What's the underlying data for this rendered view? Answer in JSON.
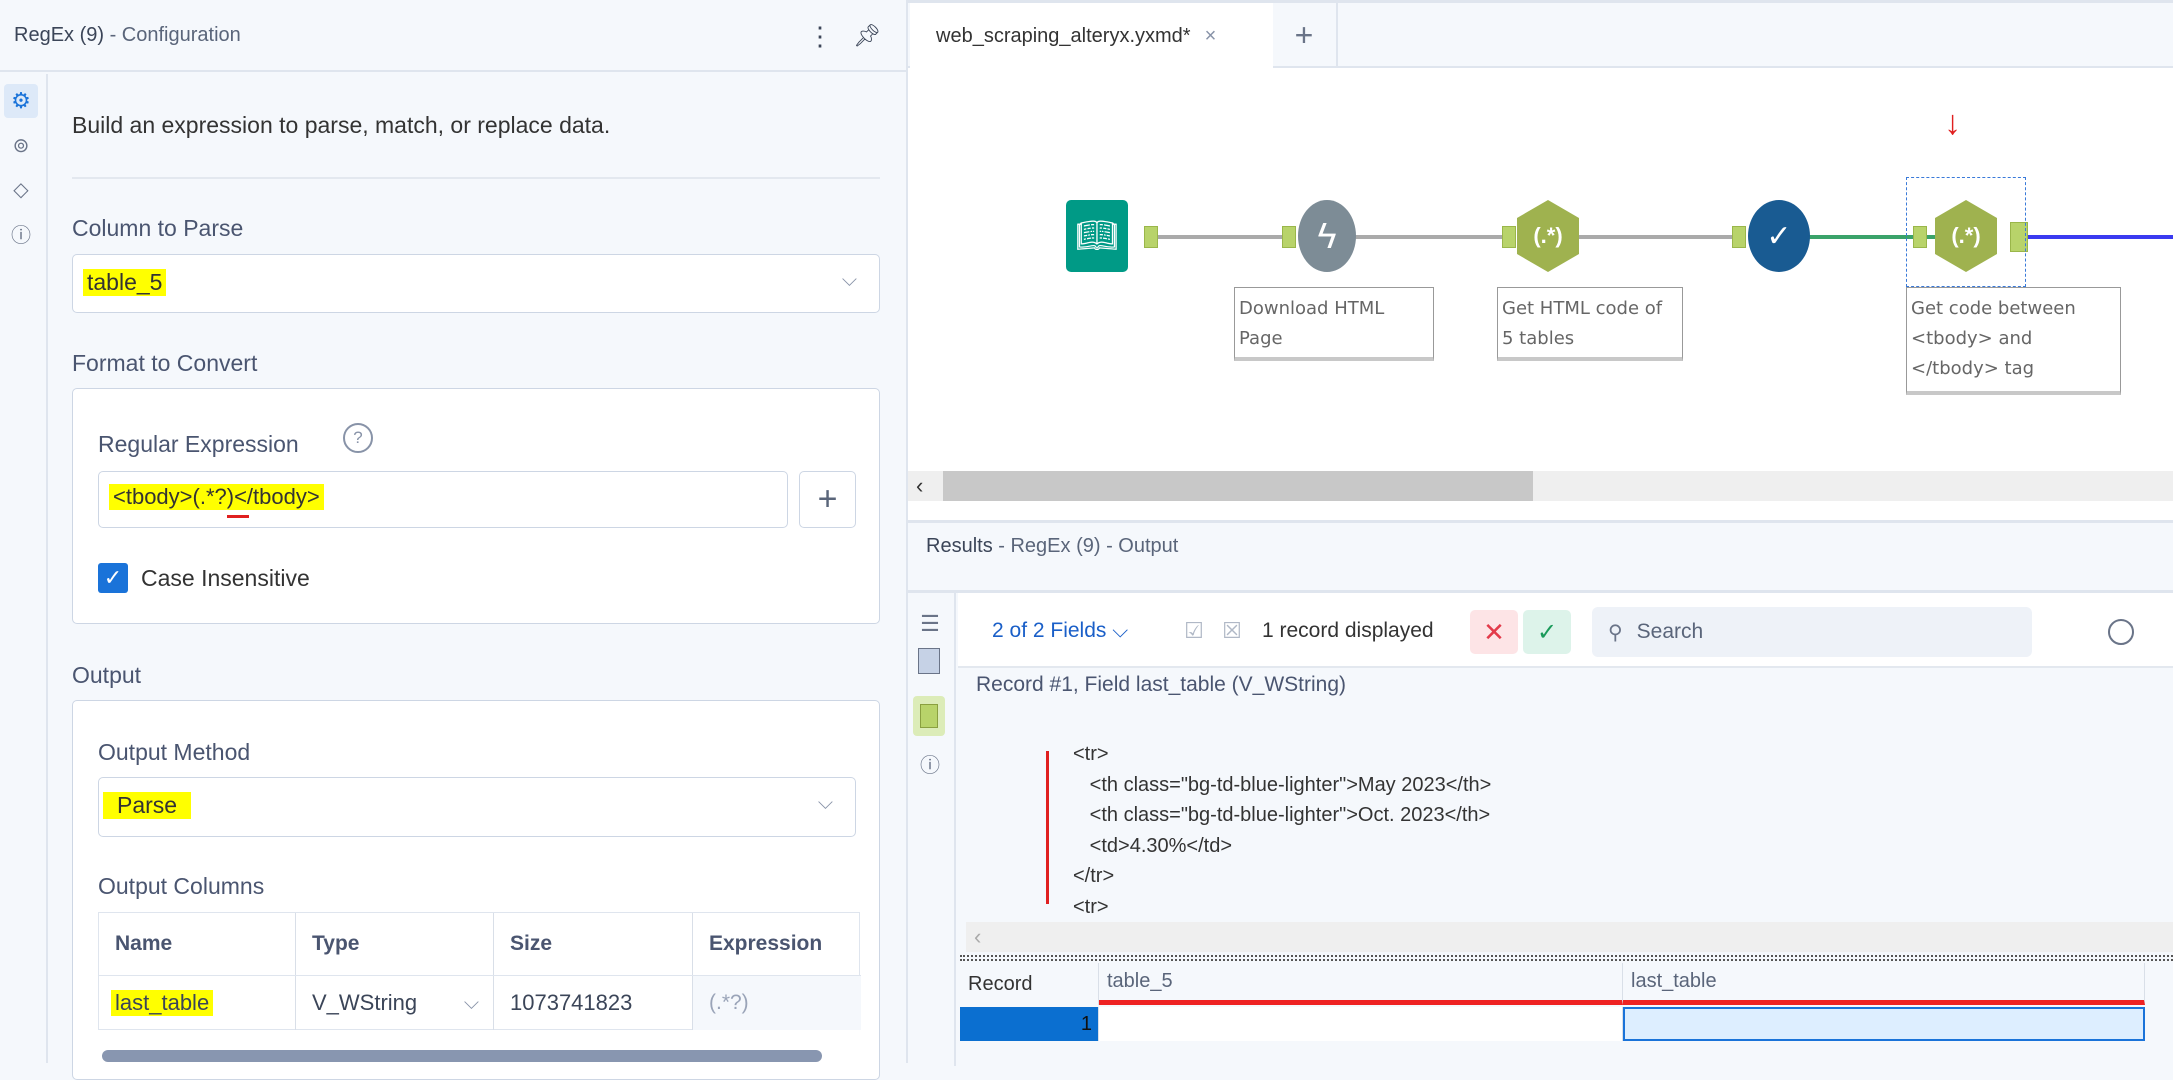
{
  "config": {
    "title_tool": "RegEx (9)",
    "title_suffix": "- Configuration",
    "description": "Build an expression to parse, match, or replace data.",
    "column_to_parse_label": "Column to Parse",
    "column_to_parse_value": "table_5",
    "format_label": "Format to Convert",
    "regex_label": "Regular Expression",
    "regex_value": "<tbody>(.*?)</tbody>",
    "case_insensitive_label": "Case Insensitive",
    "case_insensitive_checked": true,
    "output_label": "Output",
    "output_method_label": "Output Method",
    "output_method_value": "Parse",
    "output_columns_label": "Output Columns",
    "columns_headers": [
      "Name",
      "Type",
      "Size",
      "Expression"
    ],
    "columns_row": [
      "last_table",
      "V_WString",
      "1073741823",
      "(.*?)"
    ]
  },
  "canvas": {
    "tab_label": "web_scraping_alteryx.yxmd*",
    "add_tab": "+",
    "tools": [
      {
        "name": "input-data",
        "color": "#009a86"
      },
      {
        "name": "download",
        "color": "#7d8c96",
        "label": "Download HTML Page"
      },
      {
        "name": "regex",
        "color": "#9fb24f",
        "label": "Get HTML code of 5 tables",
        "glyph": "(.*)"
      },
      {
        "name": "data-cleansing",
        "color": "#195b92"
      },
      {
        "name": "regex",
        "color": "#9fb24f",
        "label": "Get code between <tbody> and </tbody> tag",
        "glyph": "(.*)"
      }
    ]
  },
  "results": {
    "title": "Results",
    "subtitle": "- RegEx (9) - Output",
    "fields": "2 of 2 Fields",
    "records": "1 record displayed",
    "search_placeholder": "Search",
    "record_info": "Record #1, Field last_table (V_WString)",
    "code_lines": [
      "<tr>",
      "   <th class=\"bg-td-blue-lighter\">May 2023</th>",
      "   <th class=\"bg-td-blue-lighter\">Oct. 2023</th>",
      "   <td>4.30%</td>",
      "</tr>",
      "<tr>"
    ],
    "grid_headers": [
      "Record",
      "table_5",
      "last_table"
    ],
    "grid_row": [
      "1",
      "",
      ""
    ]
  }
}
